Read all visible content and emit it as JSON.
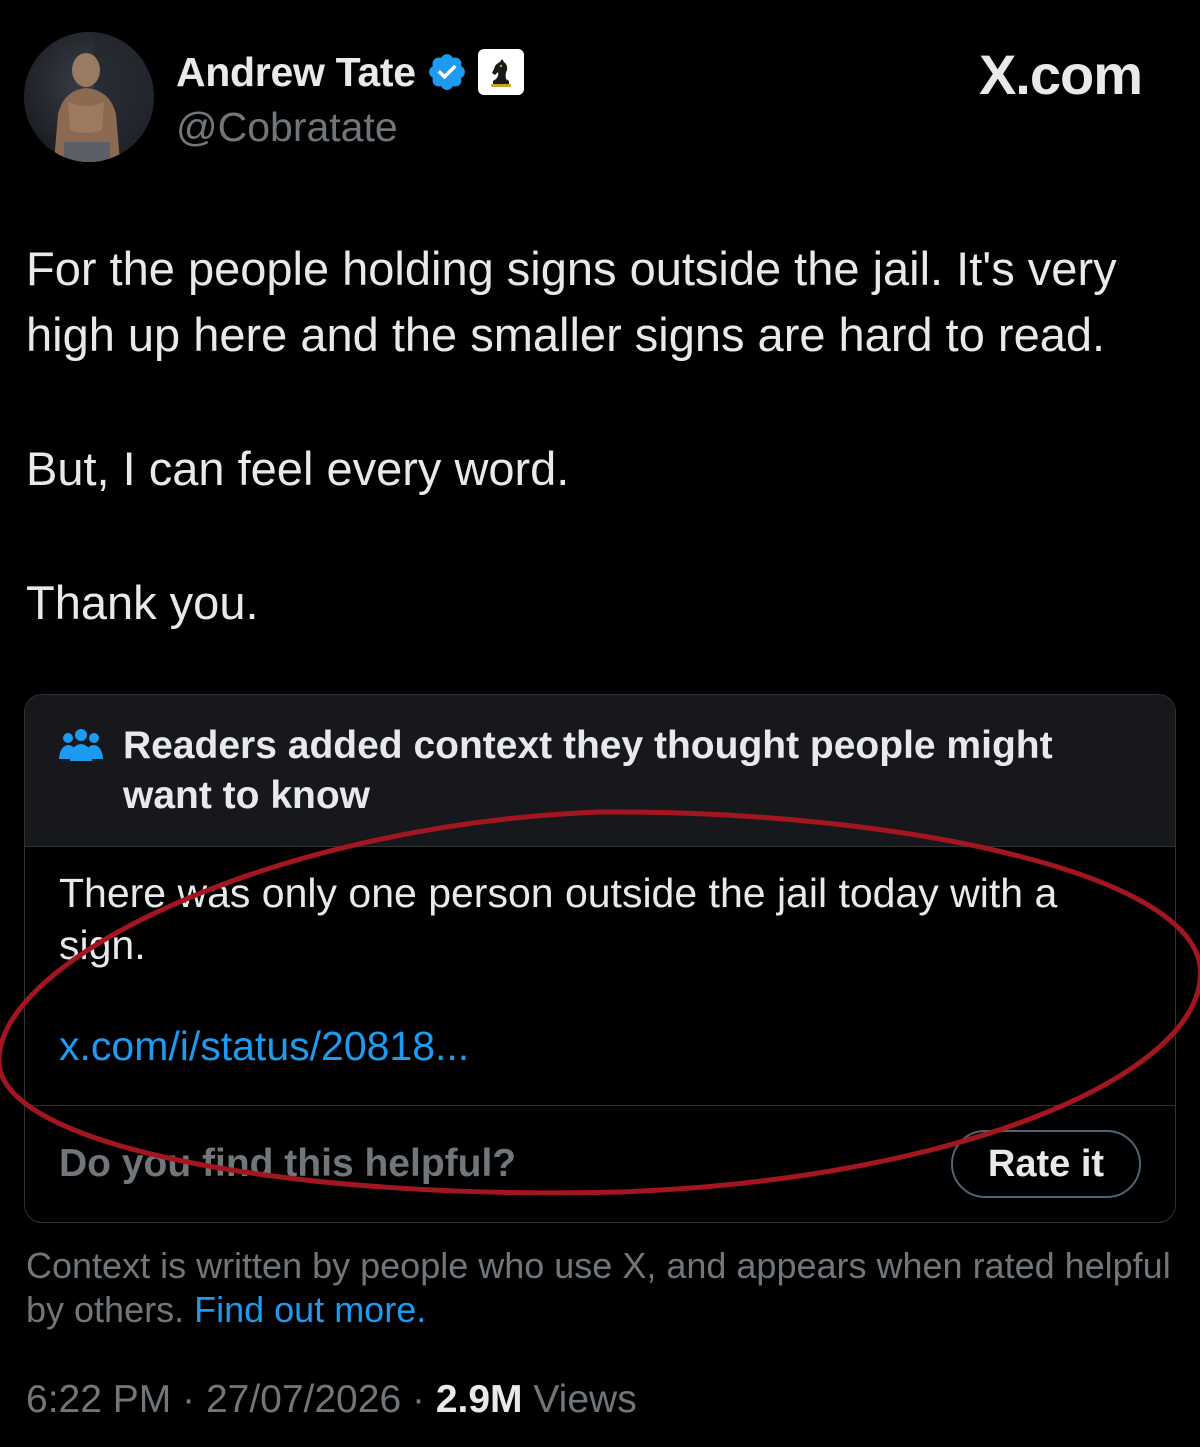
{
  "brand": {
    "label": "X.com"
  },
  "author": {
    "display_name": "Andrew Tate",
    "handle": "@Cobratate",
    "verified_icon": "verified-badge-icon",
    "affiliate_icon": "chess-knight-icon"
  },
  "tweet": {
    "paragraphs": [
      "For the people holding signs outside the jail. It's very high up here and the smaller signs are hard to read.",
      "But, I can feel every word.",
      "Thank you."
    ]
  },
  "community_note": {
    "title": "Readers added context they thought people might want to know",
    "header_icon": "readers-icon",
    "body": "There was only one person outside the jail today with a sign.",
    "link": "x.com/i/status/20818...",
    "helpful_question": "Do you find this helpful?",
    "rate_button": "Rate it"
  },
  "disclaimer": {
    "text": "Context is written by people who use X, and appears when rated helpful by others.",
    "link": "Find out more."
  },
  "meta": {
    "time": "6:22 PM",
    "separator": "·",
    "date": "27/07/2026",
    "views_count": "2.9M",
    "views_label": "Views"
  },
  "colors": {
    "background": "#000000",
    "text_primary": "#e7e9ea",
    "text_secondary": "#71767b",
    "link": "#1d9bf0",
    "verified": "#1d9bf0",
    "annotation": "#a3161f"
  }
}
